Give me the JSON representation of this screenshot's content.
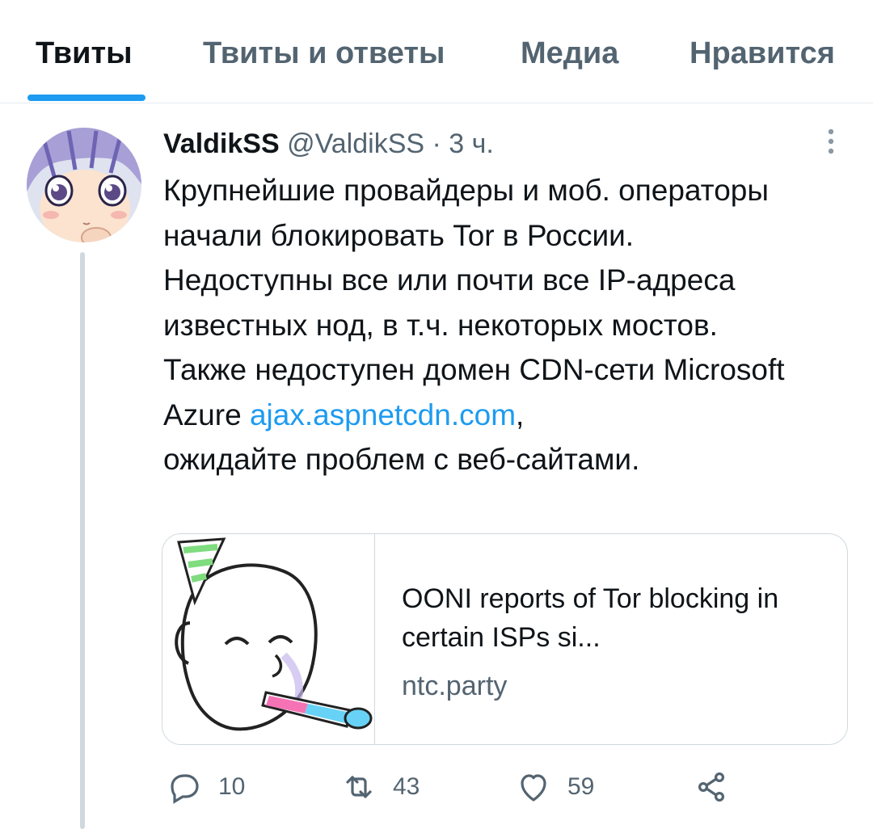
{
  "tabs": [
    {
      "label": "Твиты",
      "active": true
    },
    {
      "label": "Твиты и ответы",
      "active": false
    },
    {
      "label": "Медиа",
      "active": false
    },
    {
      "label": "Нравится",
      "active": false
    }
  ],
  "tweet": {
    "author_name": "ValdikSS",
    "author_handle": "@ValdikSS",
    "separator": "·",
    "time": "3 ч.",
    "text_before_link": "Крупнейшие провайдеры и моб. операторы начали блокировать Tor в России.\nНедоступны все или почти все IP-адреса известных нод, в т.ч. некоторых мостов.\nТакже недоступен домен CDN-сети Microsoft Azure",
    "link_text": "ajax.aspnetcdn.com",
    "text_after_link": ",\nожидайте проблем с веб-сайтами.",
    "card": {
      "title": "OONI reports of Tor blocking in certain ISPs si...",
      "domain": "ntc.party"
    },
    "actions": {
      "replies": "10",
      "retweets": "43",
      "likes": "59"
    }
  },
  "icons": {
    "reply": "reply-icon",
    "retweet": "retweet-icon",
    "like": "heart-icon",
    "share": "share-icon",
    "more": "more-vertical-icon"
  },
  "colors": {
    "accent": "#1d9bf0",
    "text": "#0f1419",
    "secondary": "#536471",
    "border": "#cfd9de"
  }
}
